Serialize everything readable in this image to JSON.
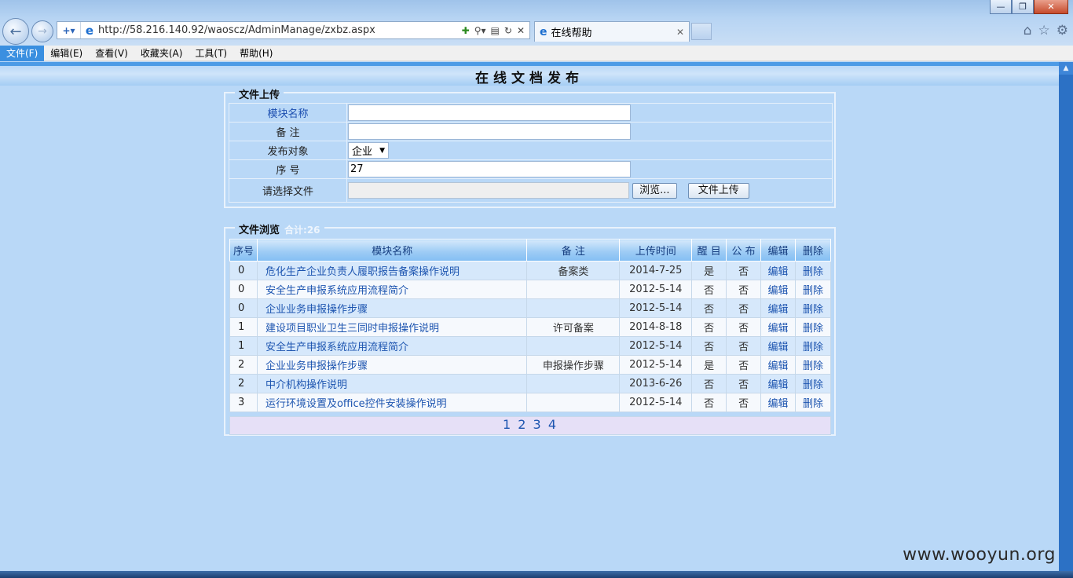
{
  "browser": {
    "url": "http://58.216.140.92/waoscz/AdminManage/zxbz.aspx",
    "tab_title": "在线帮助"
  },
  "menu": [
    {
      "label": "文件(F)"
    },
    {
      "label": "编辑(E)"
    },
    {
      "label": "查看(V)"
    },
    {
      "label": "收藏夹(A)"
    },
    {
      "label": "工具(T)"
    },
    {
      "label": "帮助(H)"
    }
  ],
  "page": {
    "title": "在线文档发布"
  },
  "upload": {
    "legend": "文件上传",
    "module_name_label": "模块名称",
    "module_name_value": "",
    "remark_label": "备 注",
    "remark_value": "",
    "target_label": "发布对象",
    "target_value": "企业",
    "seq_label": "序 号",
    "seq_value": "27",
    "file_label": "请选择文件",
    "browse_label": "浏览...",
    "upload_button": "文件上传"
  },
  "browse": {
    "legend": "文件浏览",
    "count_text": "合计:26",
    "headers": [
      "序号",
      "模块名称",
      "备 注",
      "上传时间",
      "醒 目",
      "公 布",
      "编辑",
      "删除"
    ],
    "rows": [
      {
        "no": "0",
        "name": "危化生产企业负责人履职报告备案操作说明",
        "remark": "备案类",
        "time": "2014-7-25",
        "highlight": "是",
        "publish": "否",
        "edit": "编辑",
        "del": "删除"
      },
      {
        "no": "0",
        "name": "安全生产申报系统应用流程简介",
        "remark": "",
        "time": "2012-5-14",
        "highlight": "否",
        "publish": "否",
        "edit": "编辑",
        "del": "删除"
      },
      {
        "no": "0",
        "name": "企业业务申报操作步骤",
        "remark": "",
        "time": "2012-5-14",
        "highlight": "否",
        "publish": "否",
        "edit": "编辑",
        "del": "删除"
      },
      {
        "no": "1",
        "name": "建设项目职业卫生三同时申报操作说明",
        "remark": "许可备案",
        "time": "2014-8-18",
        "highlight": "否",
        "publish": "否",
        "edit": "编辑",
        "del": "删除"
      },
      {
        "no": "1",
        "name": "安全生产申报系统应用流程简介",
        "remark": "",
        "time": "2012-5-14",
        "highlight": "否",
        "publish": "否",
        "edit": "编辑",
        "del": "删除"
      },
      {
        "no": "2",
        "name": "企业业务申报操作步骤",
        "remark": "申报操作步骤",
        "time": "2012-5-14",
        "highlight": "是",
        "publish": "否",
        "edit": "编辑",
        "del": "删除"
      },
      {
        "no": "2",
        "name": "中介机构操作说明",
        "remark": "",
        "time": "2013-6-26",
        "highlight": "否",
        "publish": "否",
        "edit": "编辑",
        "del": "删除"
      },
      {
        "no": "3",
        "name": "运行环境设置及office控件安装操作说明",
        "remark": "",
        "time": "2012-5-14",
        "highlight": "否",
        "publish": "否",
        "edit": "编辑",
        "del": "删除"
      }
    ],
    "pages": [
      "1",
      "2",
      "3",
      "4"
    ]
  },
  "watermark": "www.wooyun.org"
}
